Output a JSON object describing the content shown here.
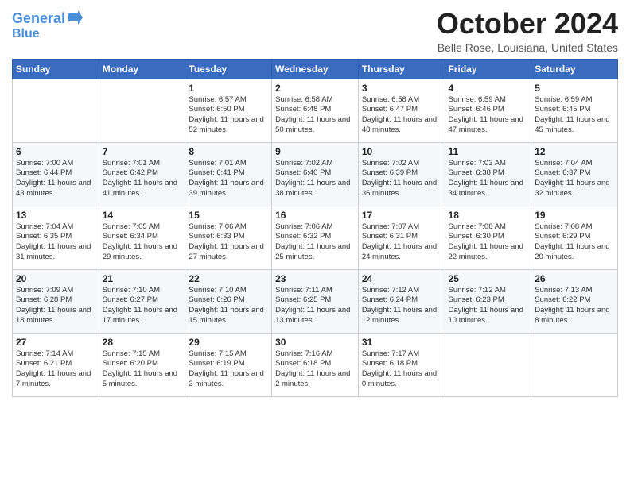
{
  "logo": {
    "line1": "General",
    "line2": "Blue"
  },
  "title": "October 2024",
  "location": "Belle Rose, Louisiana, United States",
  "weekdays": [
    "Sunday",
    "Monday",
    "Tuesday",
    "Wednesday",
    "Thursday",
    "Friday",
    "Saturday"
  ],
  "weeks": [
    [
      {
        "day": "",
        "info": ""
      },
      {
        "day": "",
        "info": ""
      },
      {
        "day": "1",
        "info": "Sunrise: 6:57 AM\nSunset: 6:50 PM\nDaylight: 11 hours and 52 minutes."
      },
      {
        "day": "2",
        "info": "Sunrise: 6:58 AM\nSunset: 6:48 PM\nDaylight: 11 hours and 50 minutes."
      },
      {
        "day": "3",
        "info": "Sunrise: 6:58 AM\nSunset: 6:47 PM\nDaylight: 11 hours and 48 minutes."
      },
      {
        "day": "4",
        "info": "Sunrise: 6:59 AM\nSunset: 6:46 PM\nDaylight: 11 hours and 47 minutes."
      },
      {
        "day": "5",
        "info": "Sunrise: 6:59 AM\nSunset: 6:45 PM\nDaylight: 11 hours and 45 minutes."
      }
    ],
    [
      {
        "day": "6",
        "info": "Sunrise: 7:00 AM\nSunset: 6:44 PM\nDaylight: 11 hours and 43 minutes."
      },
      {
        "day": "7",
        "info": "Sunrise: 7:01 AM\nSunset: 6:42 PM\nDaylight: 11 hours and 41 minutes."
      },
      {
        "day": "8",
        "info": "Sunrise: 7:01 AM\nSunset: 6:41 PM\nDaylight: 11 hours and 39 minutes."
      },
      {
        "day": "9",
        "info": "Sunrise: 7:02 AM\nSunset: 6:40 PM\nDaylight: 11 hours and 38 minutes."
      },
      {
        "day": "10",
        "info": "Sunrise: 7:02 AM\nSunset: 6:39 PM\nDaylight: 11 hours and 36 minutes."
      },
      {
        "day": "11",
        "info": "Sunrise: 7:03 AM\nSunset: 6:38 PM\nDaylight: 11 hours and 34 minutes."
      },
      {
        "day": "12",
        "info": "Sunrise: 7:04 AM\nSunset: 6:37 PM\nDaylight: 11 hours and 32 minutes."
      }
    ],
    [
      {
        "day": "13",
        "info": "Sunrise: 7:04 AM\nSunset: 6:35 PM\nDaylight: 11 hours and 31 minutes."
      },
      {
        "day": "14",
        "info": "Sunrise: 7:05 AM\nSunset: 6:34 PM\nDaylight: 11 hours and 29 minutes."
      },
      {
        "day": "15",
        "info": "Sunrise: 7:06 AM\nSunset: 6:33 PM\nDaylight: 11 hours and 27 minutes."
      },
      {
        "day": "16",
        "info": "Sunrise: 7:06 AM\nSunset: 6:32 PM\nDaylight: 11 hours and 25 minutes."
      },
      {
        "day": "17",
        "info": "Sunrise: 7:07 AM\nSunset: 6:31 PM\nDaylight: 11 hours and 24 minutes."
      },
      {
        "day": "18",
        "info": "Sunrise: 7:08 AM\nSunset: 6:30 PM\nDaylight: 11 hours and 22 minutes."
      },
      {
        "day": "19",
        "info": "Sunrise: 7:08 AM\nSunset: 6:29 PM\nDaylight: 11 hours and 20 minutes."
      }
    ],
    [
      {
        "day": "20",
        "info": "Sunrise: 7:09 AM\nSunset: 6:28 PM\nDaylight: 11 hours and 18 minutes."
      },
      {
        "day": "21",
        "info": "Sunrise: 7:10 AM\nSunset: 6:27 PM\nDaylight: 11 hours and 17 minutes."
      },
      {
        "day": "22",
        "info": "Sunrise: 7:10 AM\nSunset: 6:26 PM\nDaylight: 11 hours and 15 minutes."
      },
      {
        "day": "23",
        "info": "Sunrise: 7:11 AM\nSunset: 6:25 PM\nDaylight: 11 hours and 13 minutes."
      },
      {
        "day": "24",
        "info": "Sunrise: 7:12 AM\nSunset: 6:24 PM\nDaylight: 11 hours and 12 minutes."
      },
      {
        "day": "25",
        "info": "Sunrise: 7:12 AM\nSunset: 6:23 PM\nDaylight: 11 hours and 10 minutes."
      },
      {
        "day": "26",
        "info": "Sunrise: 7:13 AM\nSunset: 6:22 PM\nDaylight: 11 hours and 8 minutes."
      }
    ],
    [
      {
        "day": "27",
        "info": "Sunrise: 7:14 AM\nSunset: 6:21 PM\nDaylight: 11 hours and 7 minutes."
      },
      {
        "day": "28",
        "info": "Sunrise: 7:15 AM\nSunset: 6:20 PM\nDaylight: 11 hours and 5 minutes."
      },
      {
        "day": "29",
        "info": "Sunrise: 7:15 AM\nSunset: 6:19 PM\nDaylight: 11 hours and 3 minutes."
      },
      {
        "day": "30",
        "info": "Sunrise: 7:16 AM\nSunset: 6:18 PM\nDaylight: 11 hours and 2 minutes."
      },
      {
        "day": "31",
        "info": "Sunrise: 7:17 AM\nSunset: 6:18 PM\nDaylight: 11 hours and 0 minutes."
      },
      {
        "day": "",
        "info": ""
      },
      {
        "day": "",
        "info": ""
      }
    ]
  ]
}
